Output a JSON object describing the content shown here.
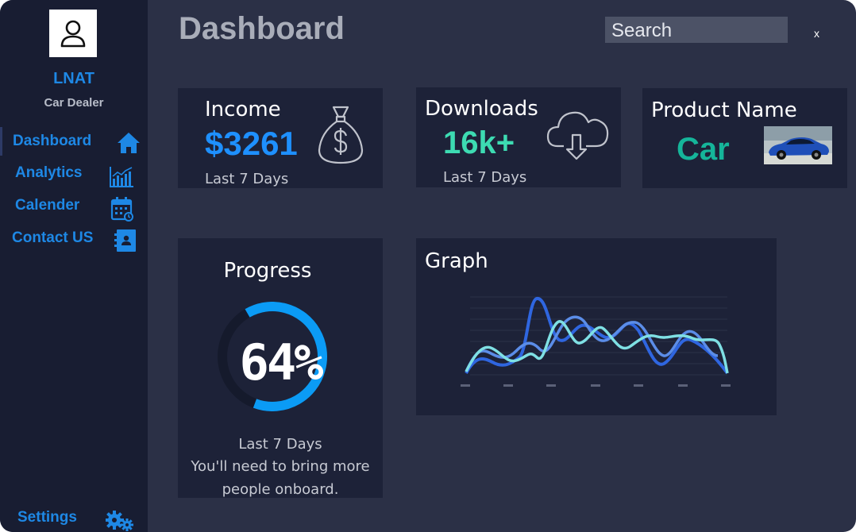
{
  "header": {
    "title": "Dashboard",
    "search_placeholder": "Search",
    "close_label": "x"
  },
  "sidebar": {
    "brand_name": "LNAT",
    "brand_subtitle": "Car Dealer",
    "items": [
      {
        "label": "Dashboard",
        "icon": "home-icon"
      },
      {
        "label": "Analytics",
        "icon": "bar-chart-icon"
      },
      {
        "label": "Calender",
        "icon": "calendar-icon"
      },
      {
        "label": "Contact US",
        "icon": "contact-book-icon"
      }
    ],
    "settings": {
      "label": "Settings",
      "icon": "gears-icon"
    }
  },
  "cards": {
    "income": {
      "label": "Income",
      "value": "$3261",
      "period": "Last 7 Days",
      "icon": "money-bag-icon"
    },
    "downloads": {
      "label": "Downloads",
      "value": "16k+",
      "period": "Last 7 Days",
      "icon": "cloud-download-icon"
    },
    "product": {
      "label": "Product Name",
      "value": "Car",
      "image": "blue-sports-car-photo"
    }
  },
  "progress": {
    "title": "Progress",
    "percent": 64,
    "percent_label": "64%",
    "period": "Last 7 Days",
    "message_line1": "You'll need to bring more",
    "message_line2": "people onboard."
  },
  "graph": {
    "title": "Graph"
  },
  "colors": {
    "background": "#2b3046",
    "sidebar": "#181d32",
    "card": "#1d2238",
    "accent_blue": "#1e88e5",
    "income_value": "#1e90ff",
    "downloads_value": "#3ddbb2",
    "product_value": "#15b59a",
    "progress_ring": "#0b9bf5"
  }
}
